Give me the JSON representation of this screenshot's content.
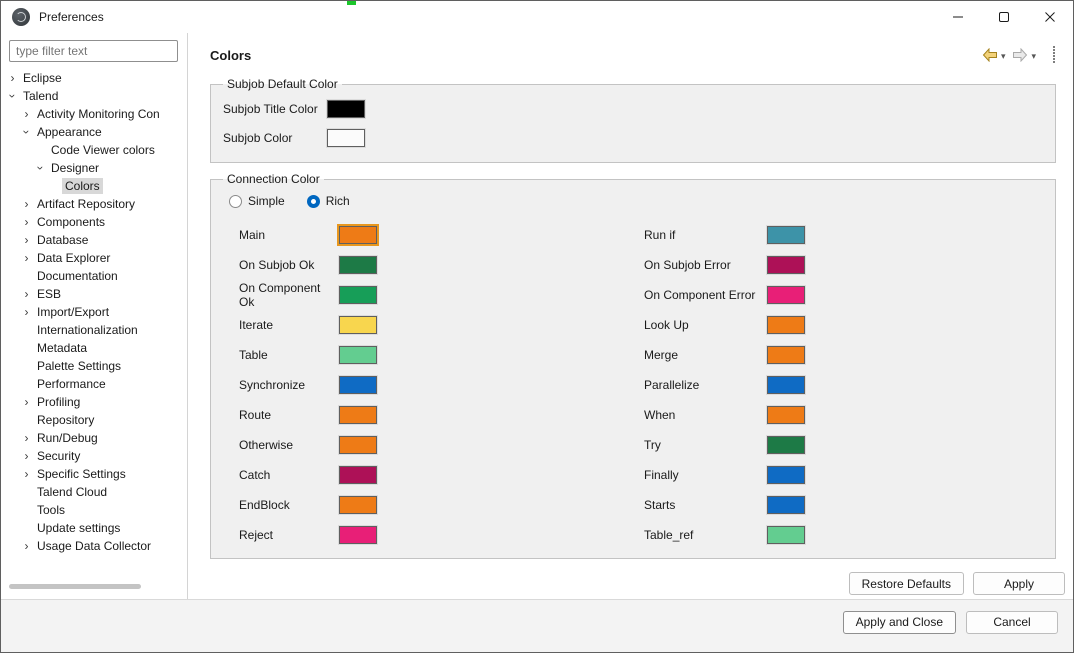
{
  "window": {
    "title": "Preferences"
  },
  "colors": {
    "accent": "#0067c0",
    "focus_ring": "#e8971e"
  },
  "sidebar": {
    "filter_placeholder": "type filter text",
    "tree": [
      {
        "label": "Eclipse",
        "level": 0,
        "state": "collapsed"
      },
      {
        "label": "Talend",
        "level": 0,
        "state": "expanded"
      },
      {
        "label": "Activity Monitoring Con",
        "level": 1,
        "state": "collapsed"
      },
      {
        "label": "Appearance",
        "level": 1,
        "state": "expanded"
      },
      {
        "label": "Code Viewer colors",
        "level": 2,
        "state": "leaf"
      },
      {
        "label": "Designer",
        "level": 2,
        "state": "expanded"
      },
      {
        "label": "Colors",
        "level": 3,
        "state": "leaf",
        "selected": true
      },
      {
        "label": "Artifact Repository",
        "level": 1,
        "state": "collapsed"
      },
      {
        "label": "Components",
        "level": 1,
        "state": "collapsed"
      },
      {
        "label": "Database",
        "level": 1,
        "state": "collapsed"
      },
      {
        "label": "Data Explorer",
        "level": 1,
        "state": "collapsed"
      },
      {
        "label": "Documentation",
        "level": 1,
        "state": "leaf"
      },
      {
        "label": "ESB",
        "level": 1,
        "state": "collapsed"
      },
      {
        "label": "Import/Export",
        "level": 1,
        "state": "collapsed"
      },
      {
        "label": "Internationalization",
        "level": 1,
        "state": "leaf"
      },
      {
        "label": "Metadata",
        "level": 1,
        "state": "leaf"
      },
      {
        "label": "Palette Settings",
        "level": 1,
        "state": "leaf"
      },
      {
        "label": "Performance",
        "level": 1,
        "state": "leaf"
      },
      {
        "label": "Profiling",
        "level": 1,
        "state": "collapsed"
      },
      {
        "label": "Repository",
        "level": 1,
        "state": "leaf"
      },
      {
        "label": "Run/Debug",
        "level": 1,
        "state": "collapsed"
      },
      {
        "label": "Security",
        "level": 1,
        "state": "collapsed"
      },
      {
        "label": "Specific Settings",
        "level": 1,
        "state": "collapsed"
      },
      {
        "label": "Talend Cloud",
        "level": 1,
        "state": "leaf"
      },
      {
        "label": "Tools",
        "level": 1,
        "state": "leaf"
      },
      {
        "label": "Update settings",
        "level": 1,
        "state": "leaf"
      },
      {
        "label": "Usage Data Collector",
        "level": 1,
        "state": "collapsed"
      }
    ]
  },
  "content": {
    "page_title": "Colors",
    "subjob_group": {
      "title": "Subjob Default Color",
      "rows": [
        {
          "label": "Subjob Title Color",
          "color": "#000000"
        },
        {
          "label": "Subjob Color",
          "color": "#fbfbfb"
        }
      ]
    },
    "connection_group": {
      "title": "Connection Color",
      "radios": [
        {
          "label": "Simple",
          "selected": false
        },
        {
          "label": "Rich",
          "selected": true
        }
      ],
      "columns": {
        "left": [
          {
            "label": "Main",
            "color": "#ee7b16",
            "focused": true
          },
          {
            "label": "On Subjob Ok",
            "color": "#1d7a46"
          },
          {
            "label": "On Component Ok",
            "color": "#179e58"
          },
          {
            "label": "Iterate",
            "color": "#f8d64e"
          },
          {
            "label": "Table",
            "color": "#63cd90"
          },
          {
            "label": "Synchronize",
            "color": "#0f6bc4"
          },
          {
            "label": "Route",
            "color": "#ee7b16"
          },
          {
            "label": "Otherwise",
            "color": "#ee7b16"
          },
          {
            "label": "Catch",
            "color": "#ad1157"
          },
          {
            "label": "EndBlock",
            "color": "#ee7b16"
          },
          {
            "label": "Reject",
            "color": "#e81f77"
          }
        ],
        "right": [
          {
            "label": "Run if",
            "color": "#3d93a8"
          },
          {
            "label": "On Subjob Error",
            "color": "#ad1157"
          },
          {
            "label": "On Component Error",
            "color": "#e81f77"
          },
          {
            "label": "Look Up",
            "color": "#ee7b16"
          },
          {
            "label": "Merge",
            "color": "#ee7b16"
          },
          {
            "label": "Parallelize",
            "color": "#0f6bc4"
          },
          {
            "label": "When",
            "color": "#ee7b16"
          },
          {
            "label": "Try",
            "color": "#1d7a46"
          },
          {
            "label": "Finally",
            "color": "#0f6bc4"
          },
          {
            "label": "Starts",
            "color": "#0f6bc4"
          },
          {
            "label": "Table_ref",
            "color": "#63cd90"
          }
        ]
      }
    },
    "buttons": {
      "restore_defaults": "Restore Defaults",
      "apply": "Apply"
    }
  },
  "footer": {
    "apply_and_close": "Apply and Close",
    "cancel": "Cancel"
  }
}
